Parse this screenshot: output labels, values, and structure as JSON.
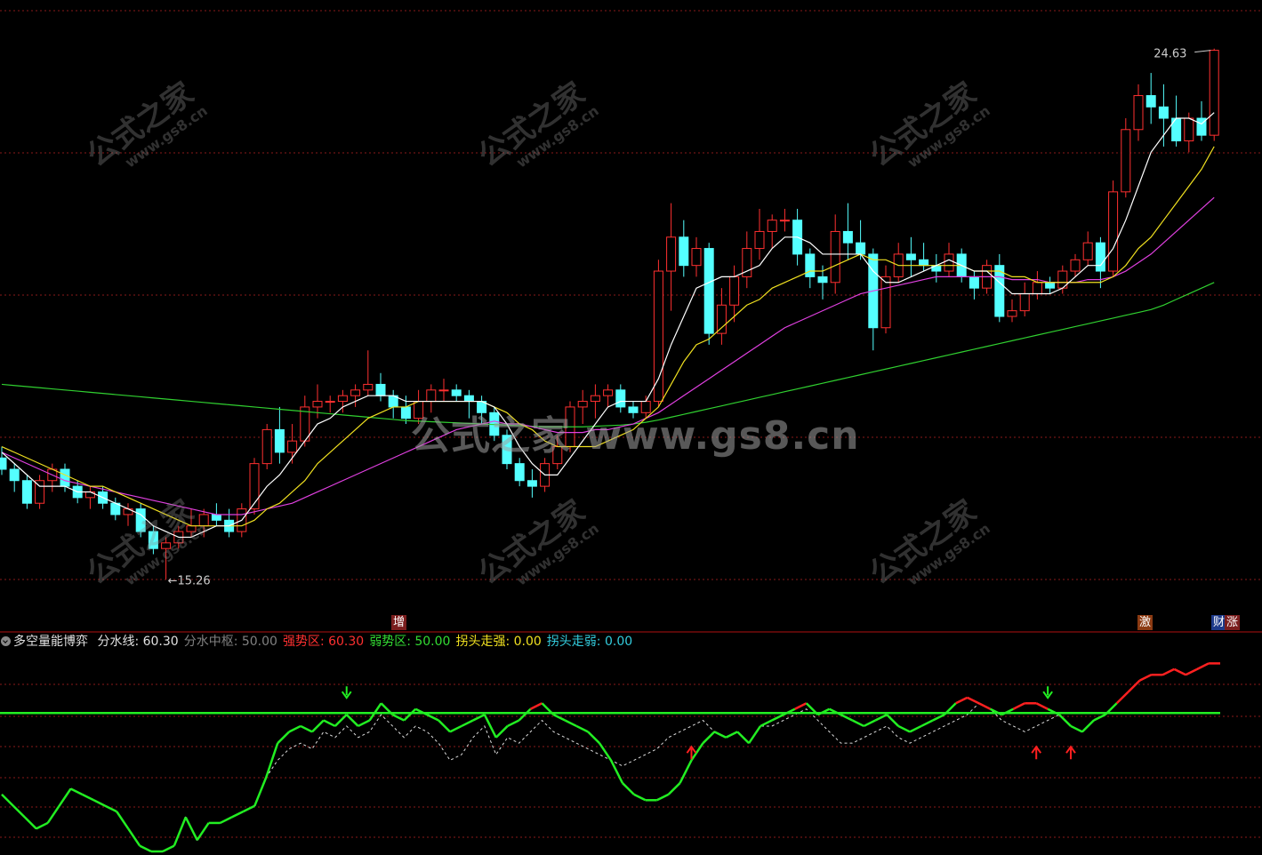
{
  "watermark": {
    "main": "公式之家 www.gs8.cn",
    "stamp": "公式之家",
    "stamp_url": "www.gs8.cn"
  },
  "price_labels": {
    "high": "24.63",
    "low": "15.26"
  },
  "markers": {
    "zeng": "增",
    "ji": "激",
    "cai": "财",
    "zhang": "涨"
  },
  "indicator_header": {
    "name": "多空量能博弈",
    "items": [
      {
        "label": "分水线:",
        "value": "60.30",
        "color": "#e0e0e0"
      },
      {
        "label": "分水中枢:",
        "value": "50.00",
        "color": "#808080"
      },
      {
        "label": "强势区:",
        "value": "60.30",
        "color": "#ff3030"
      },
      {
        "label": "弱势区:",
        "value": "50.00",
        "color": "#33dd33"
      },
      {
        "label": "拐头走强:",
        "value": "0.00",
        "color": "#f0e020"
      },
      {
        "label": "拐头走弱:",
        "value": "0.00",
        "color": "#33ccdd"
      }
    ]
  },
  "colors": {
    "up": "#ff3030",
    "down": "#54ffff",
    "ma5": "#ffffff",
    "ma10": "#f0e020",
    "ma20": "#e040e0",
    "ma60": "#30d030",
    "grid": "#8a1a1a"
  },
  "chart_data": {
    "type": "candlestick",
    "price_ylim": [
      14.5,
      25.3
    ],
    "ohlc": [
      [
        17.4,
        17.6,
        17.1,
        17.2
      ],
      [
        17.2,
        17.3,
        16.8,
        17.0
      ],
      [
        17.0,
        17.1,
        16.5,
        16.6
      ],
      [
        16.6,
        17.1,
        16.5,
        17.0
      ],
      [
        17.0,
        17.3,
        16.8,
        17.2
      ],
      [
        17.2,
        17.3,
        16.8,
        16.9
      ],
      [
        16.9,
        17.0,
        16.6,
        16.7
      ],
      [
        16.7,
        16.9,
        16.5,
        16.8
      ],
      [
        16.8,
        16.9,
        16.5,
        16.6
      ],
      [
        16.6,
        16.7,
        16.3,
        16.4
      ],
      [
        16.4,
        16.6,
        16.2,
        16.5
      ],
      [
        16.5,
        16.6,
        16.0,
        16.1
      ],
      [
        16.1,
        16.2,
        15.7,
        15.8
      ],
      [
        15.8,
        16.0,
        15.26,
        15.9
      ],
      [
        15.9,
        16.2,
        15.8,
        16.1
      ],
      [
        16.1,
        16.5,
        16.0,
        16.2
      ],
      [
        16.2,
        16.5,
        16.0,
        16.4
      ],
      [
        16.4,
        16.6,
        16.2,
        16.3
      ],
      [
        16.3,
        16.5,
        16.0,
        16.1
      ],
      [
        16.1,
        16.6,
        16.0,
        16.5
      ],
      [
        16.5,
        17.4,
        16.4,
        17.3
      ],
      [
        17.3,
        18.0,
        17.2,
        17.9
      ],
      [
        17.9,
        18.3,
        17.3,
        17.5
      ],
      [
        17.5,
        18.0,
        17.3,
        17.7
      ],
      [
        17.7,
        18.5,
        17.6,
        18.3
      ],
      [
        18.3,
        18.7,
        18.1,
        18.4
      ],
      [
        18.4,
        18.5,
        18.2,
        18.4
      ],
      [
        18.4,
        18.6,
        18.2,
        18.5
      ],
      [
        18.5,
        18.7,
        18.3,
        18.6
      ],
      [
        18.6,
        19.3,
        18.5,
        18.7
      ],
      [
        18.7,
        18.9,
        18.4,
        18.5
      ],
      [
        18.5,
        18.6,
        18.1,
        18.3
      ],
      [
        18.3,
        18.5,
        18.0,
        18.1
      ],
      [
        18.1,
        18.6,
        18.0,
        18.4
      ],
      [
        18.4,
        18.7,
        18.2,
        18.6
      ],
      [
        18.6,
        18.8,
        18.4,
        18.6
      ],
      [
        18.6,
        18.7,
        18.4,
        18.5
      ],
      [
        18.5,
        18.6,
        18.1,
        18.4
      ],
      [
        18.4,
        18.5,
        18.0,
        18.2
      ],
      [
        18.2,
        18.3,
        17.7,
        17.8
      ],
      [
        17.8,
        17.9,
        17.2,
        17.3
      ],
      [
        17.3,
        17.4,
        16.9,
        17.0
      ],
      [
        17.0,
        17.2,
        16.7,
        16.9
      ],
      [
        16.9,
        17.4,
        16.8,
        17.3
      ],
      [
        17.3,
        17.8,
        17.2,
        17.6
      ],
      [
        17.6,
        18.4,
        17.5,
        18.3
      ],
      [
        18.3,
        18.6,
        18.0,
        18.4
      ],
      [
        18.4,
        18.7,
        18.1,
        18.5
      ],
      [
        18.5,
        18.7,
        18.3,
        18.6
      ],
      [
        18.6,
        18.7,
        18.2,
        18.3
      ],
      [
        18.3,
        18.4,
        18.1,
        18.2
      ],
      [
        18.2,
        18.5,
        18.1,
        18.4
      ],
      [
        18.4,
        20.9,
        18.3,
        20.7
      ],
      [
        20.7,
        21.9,
        20.0,
        21.3
      ],
      [
        21.3,
        21.6,
        20.6,
        20.8
      ],
      [
        20.8,
        21.3,
        20.6,
        21.1
      ],
      [
        21.1,
        21.2,
        19.4,
        19.6
      ],
      [
        19.6,
        20.4,
        19.4,
        20.1
      ],
      [
        20.1,
        20.8,
        19.8,
        20.6
      ],
      [
        20.6,
        21.4,
        20.4,
        21.1
      ],
      [
        21.1,
        21.8,
        20.9,
        21.4
      ],
      [
        21.4,
        21.7,
        21.1,
        21.6
      ],
      [
        21.6,
        21.8,
        21.4,
        21.6
      ],
      [
        21.6,
        21.8,
        20.8,
        21.0
      ],
      [
        21.0,
        21.1,
        20.4,
        20.6
      ],
      [
        20.6,
        20.8,
        20.2,
        20.5
      ],
      [
        20.5,
        21.7,
        20.3,
        21.4
      ],
      [
        21.4,
        21.9,
        20.9,
        21.2
      ],
      [
        21.2,
        21.6,
        20.9,
        21.0
      ],
      [
        21.0,
        21.1,
        19.3,
        19.7
      ],
      [
        19.7,
        20.8,
        19.6,
        20.6
      ],
      [
        20.6,
        21.2,
        20.5,
        21.0
      ],
      [
        21.0,
        21.3,
        20.6,
        20.9
      ],
      [
        20.9,
        21.2,
        20.7,
        20.8
      ],
      [
        20.8,
        21.0,
        20.5,
        20.7
      ],
      [
        20.7,
        21.2,
        20.6,
        21.0
      ],
      [
        21.0,
        21.1,
        20.5,
        20.6
      ],
      [
        20.6,
        20.7,
        20.2,
        20.4
      ],
      [
        20.4,
        20.9,
        20.3,
        20.8
      ],
      [
        20.8,
        21.0,
        19.8,
        19.9
      ],
      [
        19.9,
        20.2,
        19.8,
        20.0
      ],
      [
        20.0,
        20.5,
        19.9,
        20.3
      ],
      [
        20.3,
        20.7,
        20.2,
        20.5
      ],
      [
        20.5,
        20.6,
        20.3,
        20.4
      ],
      [
        20.4,
        20.8,
        20.3,
        20.7
      ],
      [
        20.7,
        21.0,
        20.6,
        20.9
      ],
      [
        20.9,
        21.4,
        20.8,
        21.2
      ],
      [
        21.2,
        21.3,
        20.4,
        20.7
      ],
      [
        20.7,
        22.3,
        20.6,
        22.1
      ],
      [
        22.1,
        23.4,
        22.0,
        23.2
      ],
      [
        23.2,
        24.0,
        23.0,
        23.8
      ],
      [
        23.8,
        24.2,
        23.3,
        23.6
      ],
      [
        23.6,
        24.0,
        22.9,
        23.4
      ],
      [
        23.4,
        23.8,
        22.9,
        23.0
      ],
      [
        23.0,
        23.5,
        22.8,
        23.4
      ],
      [
        23.4,
        23.7,
        23.0,
        23.1
      ],
      [
        23.1,
        24.63,
        23.0,
        24.6
      ]
    ],
    "ma5": [
      17.5,
      17.3,
      17.1,
      16.9,
      16.9,
      16.9,
      16.8,
      16.8,
      16.7,
      16.6,
      16.5,
      16.4,
      16.2,
      16.1,
      16.0,
      16.0,
      16.1,
      16.2,
      16.2,
      16.3,
      16.6,
      16.9,
      17.1,
      17.4,
      17.7,
      18.0,
      18.1,
      18.3,
      18.4,
      18.5,
      18.5,
      18.5,
      18.4,
      18.4,
      18.4,
      18.4,
      18.4,
      18.4,
      18.4,
      18.3,
      18.0,
      17.6,
      17.3,
      17.1,
      17.1,
      17.4,
      17.7,
      18.0,
      18.3,
      18.4,
      18.4,
      18.4,
      18.8,
      19.4,
      19.9,
      20.4,
      20.5,
      20.6,
      20.6,
      20.7,
      20.8,
      21.1,
      21.3,
      21.3,
      21.2,
      21.0,
      21.0,
      21.0,
      21.0,
      20.7,
      20.5,
      20.5,
      20.6,
      20.7,
      20.8,
      20.9,
      20.8,
      20.7,
      20.7,
      20.5,
      20.3,
      20.3,
      20.3,
      20.3,
      20.4,
      20.6,
      20.8,
      20.8,
      21.1,
      21.6,
      22.2,
      22.8,
      23.1,
      23.4,
      23.4,
      23.3,
      23.5
    ],
    "ma10": [
      17.6,
      17.5,
      17.4,
      17.3,
      17.2,
      17.1,
      17.0,
      16.9,
      16.9,
      16.8,
      16.7,
      16.6,
      16.5,
      16.4,
      16.3,
      16.2,
      16.2,
      16.2,
      16.2,
      16.2,
      16.3,
      16.5,
      16.6,
      16.8,
      17.0,
      17.3,
      17.5,
      17.7,
      17.9,
      18.1,
      18.2,
      18.3,
      18.3,
      18.4,
      18.4,
      18.4,
      18.4,
      18.4,
      18.4,
      18.3,
      18.2,
      18.0,
      17.9,
      17.7,
      17.6,
      17.6,
      17.6,
      17.6,
      17.7,
      17.8,
      17.9,
      18.1,
      18.3,
      18.7,
      19.1,
      19.4,
      19.5,
      19.7,
      19.9,
      20.1,
      20.2,
      20.4,
      20.5,
      20.6,
      20.7,
      20.7,
      20.8,
      20.9,
      21.0,
      20.9,
      20.9,
      20.8,
      20.8,
      20.8,
      20.8,
      20.8,
      20.8,
      20.7,
      20.7,
      20.7,
      20.6,
      20.6,
      20.5,
      20.5,
      20.5,
      20.5,
      20.5,
      20.5,
      20.6,
      20.8,
      21.1,
      21.3,
      21.6,
      21.9,
      22.2,
      22.5,
      22.9
    ],
    "ma20": [
      17.5,
      17.4,
      17.3,
      17.2,
      17.1,
      17.0,
      16.95,
      16.9,
      16.85,
      16.8,
      16.75,
      16.7,
      16.65,
      16.6,
      16.55,
      16.5,
      16.45,
      16.4,
      16.4,
      16.4,
      16.45,
      16.5,
      16.55,
      16.6,
      16.7,
      16.8,
      16.9,
      17.0,
      17.1,
      17.2,
      17.3,
      17.4,
      17.5,
      17.6,
      17.7,
      17.8,
      17.9,
      17.95,
      18.0,
      18.05,
      18.0,
      18.0,
      17.95,
      17.9,
      17.85,
      17.85,
      17.85,
      17.9,
      17.9,
      17.95,
      18.0,
      18.1,
      18.2,
      18.35,
      18.5,
      18.65,
      18.8,
      18.95,
      19.1,
      19.25,
      19.4,
      19.55,
      19.7,
      19.8,
      19.9,
      20.0,
      20.1,
      20.2,
      20.3,
      20.35,
      20.4,
      20.45,
      20.5,
      20.55,
      20.6,
      20.6,
      20.6,
      20.6,
      20.6,
      20.6,
      20.55,
      20.55,
      20.55,
      20.5,
      20.5,
      20.5,
      20.55,
      20.55,
      20.6,
      20.7,
      20.85,
      21.0,
      21.2,
      21.4,
      21.6,
      21.8,
      22.0
    ],
    "ma60": [
      18.7,
      18.68,
      18.66,
      18.64,
      18.62,
      18.6,
      18.58,
      18.56,
      18.54,
      18.52,
      18.5,
      18.48,
      18.46,
      18.44,
      18.42,
      18.4,
      18.38,
      18.36,
      18.34,
      18.32,
      18.3,
      18.28,
      18.26,
      18.24,
      18.22,
      18.2,
      18.18,
      18.16,
      18.14,
      18.12,
      18.1,
      18.08,
      18.06,
      18.05,
      18.04,
      18.03,
      18.02,
      18.01,
      18.0,
      17.99,
      17.98,
      17.97,
      17.96,
      17.95,
      17.95,
      17.95,
      17.95,
      17.96,
      17.97,
      17.98,
      18.0,
      18.03,
      18.07,
      18.12,
      18.17,
      18.22,
      18.27,
      18.32,
      18.37,
      18.42,
      18.47,
      18.52,
      18.57,
      18.62,
      18.67,
      18.72,
      18.77,
      18.82,
      18.87,
      18.92,
      18.97,
      19.02,
      19.07,
      19.12,
      19.17,
      19.22,
      19.27,
      19.32,
      19.37,
      19.42,
      19.47,
      19.52,
      19.57,
      19.62,
      19.67,
      19.72,
      19.77,
      19.82,
      19.87,
      19.92,
      19.97,
      20.02,
      20.1,
      20.2,
      20.3,
      20.4,
      20.5
    ],
    "indicator_ylim": [
      36,
      70
    ],
    "indicator": [
      46,
      44,
      42,
      40,
      41,
      44,
      47,
      46,
      45,
      44,
      43,
      40,
      37,
      36,
      36,
      37,
      42,
      38,
      41,
      41,
      42,
      43,
      44,
      49,
      55,
      57,
      58,
      57,
      59,
      58,
      60,
      58,
      59,
      62,
      60,
      59,
      61,
      60,
      59,
      57,
      58,
      59,
      60,
      56,
      58,
      59,
      61,
      62,
      60,
      59,
      58,
      57,
      55,
      52,
      48,
      46,
      45,
      45,
      46,
      48,
      52,
      55,
      57,
      56,
      57,
      55,
      58,
      59,
      60,
      61,
      62,
      60,
      61,
      60,
      59,
      58,
      59,
      60,
      58,
      57,
      58,
      59,
      60,
      62,
      63,
      62,
      61,
      60,
      61,
      62,
      62,
      61,
      60,
      58,
      57,
      59,
      60,
      62,
      64,
      66,
      67,
      67,
      68,
      67,
      68,
      69,
      69
    ],
    "indicator_white": [
      46,
      44,
      42,
      40,
      41,
      44,
      47,
      46,
      45,
      44,
      43,
      40,
      37,
      36,
      36,
      37,
      42,
      38,
      41,
      41,
      42,
      43,
      44,
      49,
      52,
      54,
      55,
      54,
      57,
      56,
      58,
      56,
      57,
      60,
      58,
      56,
      58,
      57,
      55,
      52,
      53,
      56,
      58,
      53,
      56,
      55,
      57,
      59,
      57,
      56,
      55,
      54,
      53,
      52,
      51,
      52,
      53,
      54,
      56,
      57,
      58,
      59,
      57,
      56,
      57,
      55,
      58,
      58,
      59,
      60,
      61,
      59,
      57,
      55,
      55,
      56,
      57,
      58,
      56,
      55,
      56,
      57,
      58,
      59,
      60,
      62,
      61,
      59,
      58,
      57,
      58,
      59,
      60,
      58,
      57,
      59,
      60,
      62,
      64,
      66,
      67,
      67,
      68,
      67,
      68,
      69,
      69
    ],
    "divider_value": 60.3,
    "center_value": 50.0,
    "down_arrows_idx": [
      30,
      91
    ],
    "up_arrows_idx": [
      60,
      90,
      93
    ]
  }
}
